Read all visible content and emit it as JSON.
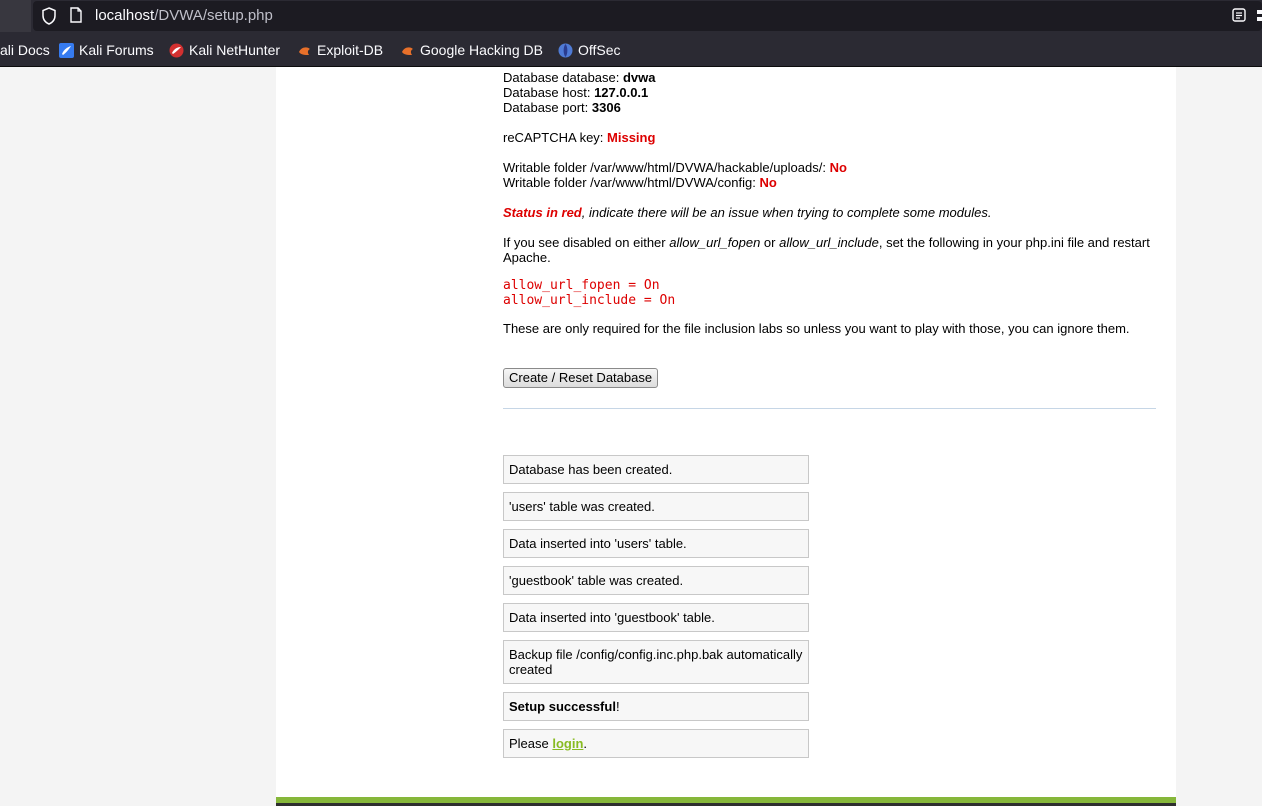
{
  "browser": {
    "url_host": "localhost",
    "url_path": "/DVWA/setup.php",
    "bookmarks": [
      {
        "label": "ali Docs",
        "icon": "kali-docs-icon"
      },
      {
        "label": "Kali Forums",
        "icon": "kali-forums-icon"
      },
      {
        "label": "Kali NetHunter",
        "icon": "kali-nethunter-icon"
      },
      {
        "label": "Exploit-DB",
        "icon": "exploit-db-icon"
      },
      {
        "label": "Google Hacking DB",
        "icon": "google-hacking-db-icon"
      },
      {
        "label": "OffSec",
        "icon": "offsec-icon"
      }
    ]
  },
  "setup": {
    "db_database_label": "Database database: ",
    "db_database_value": "dvwa",
    "db_host_label": "Database host: ",
    "db_host_value": "127.0.0.1",
    "db_port_label": "Database port: ",
    "db_port_value": "3306",
    "recaptcha_label": "reCAPTCHA key: ",
    "recaptcha_value": "Missing",
    "writable_uploads_label": "Writable folder /var/www/html/DVWA/hackable/uploads/: ",
    "writable_uploads_value": "No",
    "writable_config_label": "Writable folder /var/www/html/DVWA/config: ",
    "writable_config_value": "No",
    "status_red": "Status in red",
    "status_note": ", indicate there will be an issue when trying to complete some modules.",
    "disabled_pre": "If you see disabled on either ",
    "disabled_opt1": "allow_url_fopen",
    "disabled_or": " or ",
    "disabled_opt2": "allow_url_include",
    "disabled_post": ", set the following in your php.ini file and restart",
    "disabled_post2": "Apache.",
    "code_line1": "allow_url_fopen = On",
    "code_line2": "allow_url_include = On",
    "inclusion_note": "These are only required for the file inclusion labs so unless you want to play with those, you can ignore them.",
    "button_label": "Create / Reset Database"
  },
  "messages": {
    "m1": "Database has been created.",
    "m2": "'users' table was created.",
    "m3": "Data inserted into 'users' table.",
    "m4": "'guestbook' table was created.",
    "m5": "Data inserted into 'guestbook' table.",
    "m6_line1": "Backup file /config/config.inc.php.bak automatically",
    "m6_line2": "created",
    "m7_bold": "Setup successful",
    "m7_rest": "!",
    "m8_pre": "Please ",
    "m8_link": "login",
    "m8_post": "."
  },
  "colors": {
    "status_red": "#dd0000",
    "link_green": "#88bb22",
    "footer_green": "#86b73a"
  }
}
